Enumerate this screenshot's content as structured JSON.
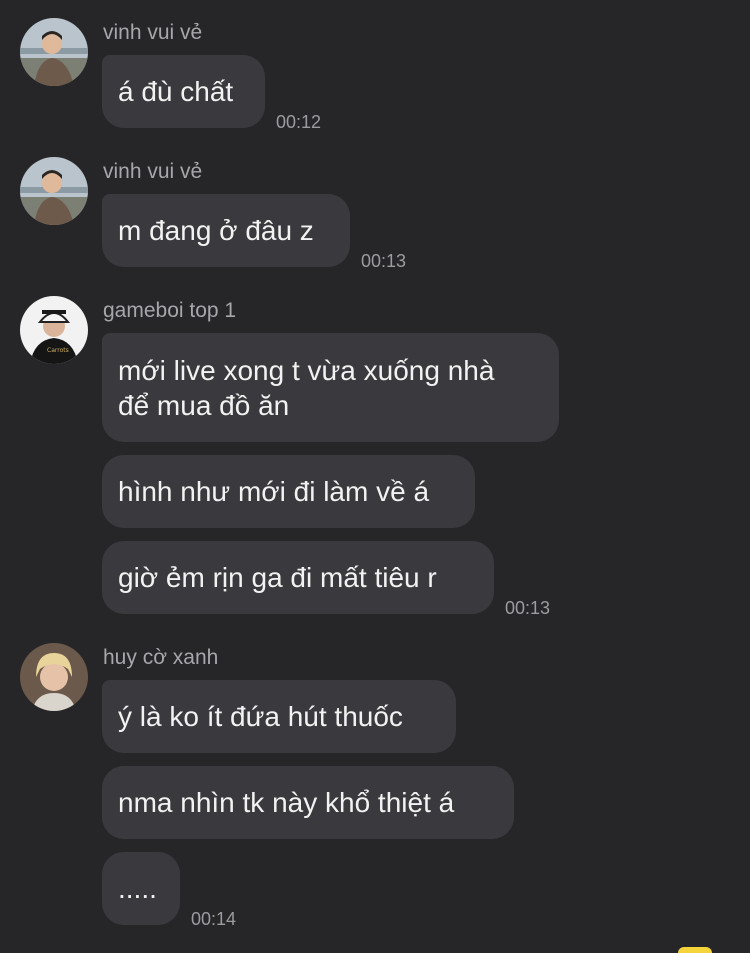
{
  "conversation": [
    {
      "sender": "vinh vui vẻ",
      "messages": [
        {
          "text": "á đù chất",
          "time": "00:12"
        }
      ]
    },
    {
      "sender": "vinh vui vẻ",
      "messages": [
        {
          "text": "m đang ở đâu z",
          "time": "00:13"
        }
      ]
    },
    {
      "sender": "gameboi top 1",
      "messages": [
        {
          "text": "mới live xong t vừa xuống nhà\nđể mua đồ ăn"
        },
        {
          "text": "hình như mới đi làm về á"
        },
        {
          "text": "giờ ẻm rịn ga đi mất tiêu r",
          "time": "00:13"
        }
      ]
    },
    {
      "sender": "huy cờ xanh",
      "messages": [
        {
          "text": "ý là ko ít đứa hút thuốc"
        },
        {
          "text": "nma nhìn tk này khổ thiệt á"
        },
        {
          "text": ".....",
          "time": "00:14"
        }
      ]
    }
  ],
  "colors": {
    "background": "#262629",
    "bubble": "#3a3a3e",
    "text": "#f2f2f2",
    "sender": "#a6a6ab",
    "time": "#9b9ba0",
    "badge": "#f5d33a"
  },
  "icons": {
    "avatar_vinh": "person-photo-avatar",
    "avatar_gameboi": "person-in-cap-avatar",
    "avatar_huy": "blond-person-avatar"
  }
}
